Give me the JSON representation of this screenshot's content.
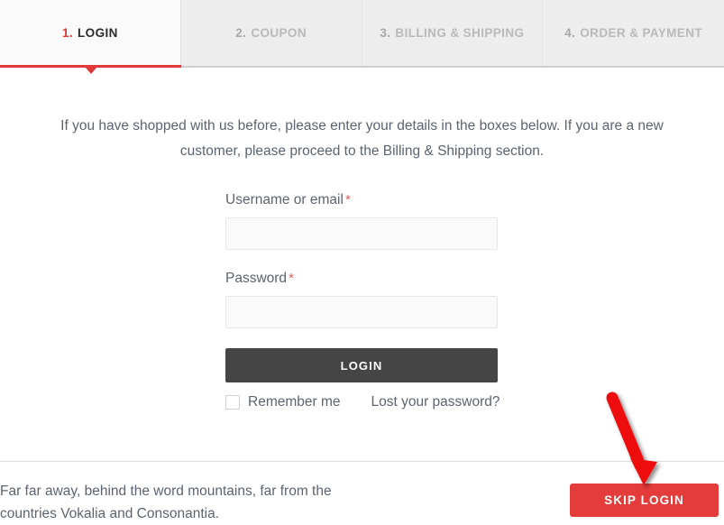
{
  "checkout": {
    "steps": [
      {
        "num": "1.",
        "label": "LOGIN",
        "active": true
      },
      {
        "num": "2.",
        "label": "COUPON",
        "active": false
      },
      {
        "num": "3.",
        "label": "BILLING & SHIPPING",
        "active": false
      },
      {
        "num": "4.",
        "label": "ORDER & PAYMENT",
        "active": false
      }
    ],
    "intro": "If you have shopped with us before, please enter your details in the boxes below. If you are a new customer, please proceed to the Billing & Shipping section.",
    "form": {
      "username_label": "Username or email",
      "username_required_mark": "*",
      "username_value": "",
      "username_placeholder": "",
      "password_label": "Password",
      "password_required_mark": "*",
      "password_value": "",
      "password_placeholder": "",
      "login_button": "LOGIN",
      "remember_label": "Remember me",
      "remember_checked": false,
      "lost_password_link": "Lost your password?"
    },
    "footer": {
      "text": "Far far away, behind the word mountains, far from the countries Vokalia and Consonantia.",
      "skip_button": "SKIP LOGIN"
    },
    "annotation": {
      "arrow_icon": "down-right-arrow-annotation",
      "arrow_color": "#ee1111"
    },
    "colors": {
      "accent_red": "#e03a3a",
      "skip_red": "#e43b3b",
      "login_dark": "#454545",
      "tab_inactive_bg": "#ededed",
      "tab_active_bg": "#fafafa",
      "body_text": "#5b6470",
      "required_star": "#e0605f"
    }
  }
}
